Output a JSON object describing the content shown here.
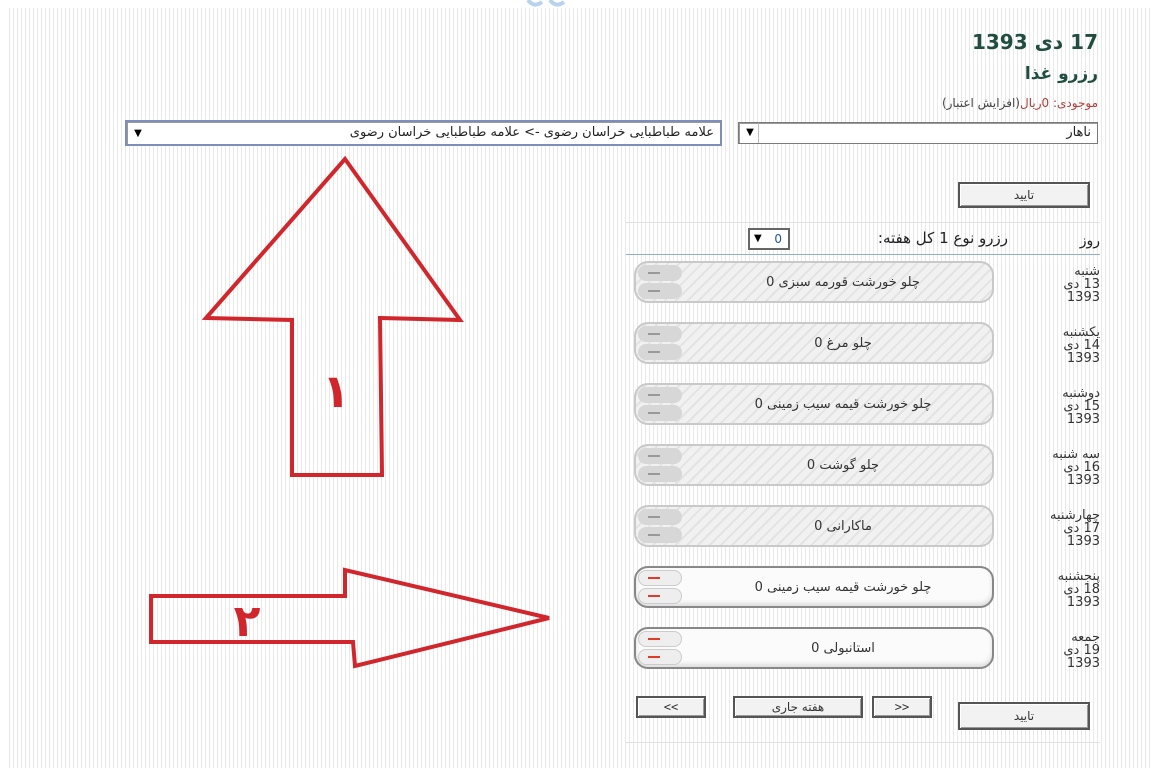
{
  "header": {
    "date": "17 دی 1393",
    "title": "رزرو غذا",
    "balance_label": "موجودی:",
    "balance_amount": "0ریال",
    "balance_link": "(افزایش اعتبار)"
  },
  "filters": {
    "meal": "ناهار",
    "location": "علامه طباطبایی خراسان رضوی -> علامه طباطبایی خراسان رضوی"
  },
  "buttons": {
    "confirm": "تایید",
    "prev": ">>",
    "current_week": "هفته جاری",
    "next": "<<"
  },
  "week": {
    "day_header": "روز",
    "type_label": "رزرو نوع 1 کل هفته:",
    "qty": "0"
  },
  "days": [
    {
      "weekday": "شنبه",
      "date": "13 دی",
      "year": "1393",
      "food": "چلو خورشت قورمه سبزی 0",
      "active": false
    },
    {
      "weekday": "یکشنبه",
      "date": "14 دی",
      "year": "1393",
      "food": "چلو مرغ 0",
      "active": false
    },
    {
      "weekday": "دوشنبه",
      "date": "15 دی",
      "year": "1393",
      "food": "چلو خورشت قیمه سیب زمینی 0",
      "active": false
    },
    {
      "weekday": "سه شنبه",
      "date": "16 دی",
      "year": "1393",
      "food": "چلو گوشت 0",
      "active": false
    },
    {
      "weekday": "چهارشنبه",
      "date": "17 دی",
      "year": "1393",
      "food": "ماکارانی 0",
      "active": false
    },
    {
      "weekday": "پنجشنبه",
      "date": "18 دی",
      "year": "1393",
      "food": "چلو خورشت قیمه سیب زمینی 0",
      "active": true
    },
    {
      "weekday": "جمعه",
      "date": "19 دی",
      "year": "1393",
      "food": "استانبولی 0",
      "active": true
    }
  ],
  "annotations": {
    "arrow_up_label": "۱",
    "arrow_right_label": "۲",
    "color": "#d0262c"
  }
}
